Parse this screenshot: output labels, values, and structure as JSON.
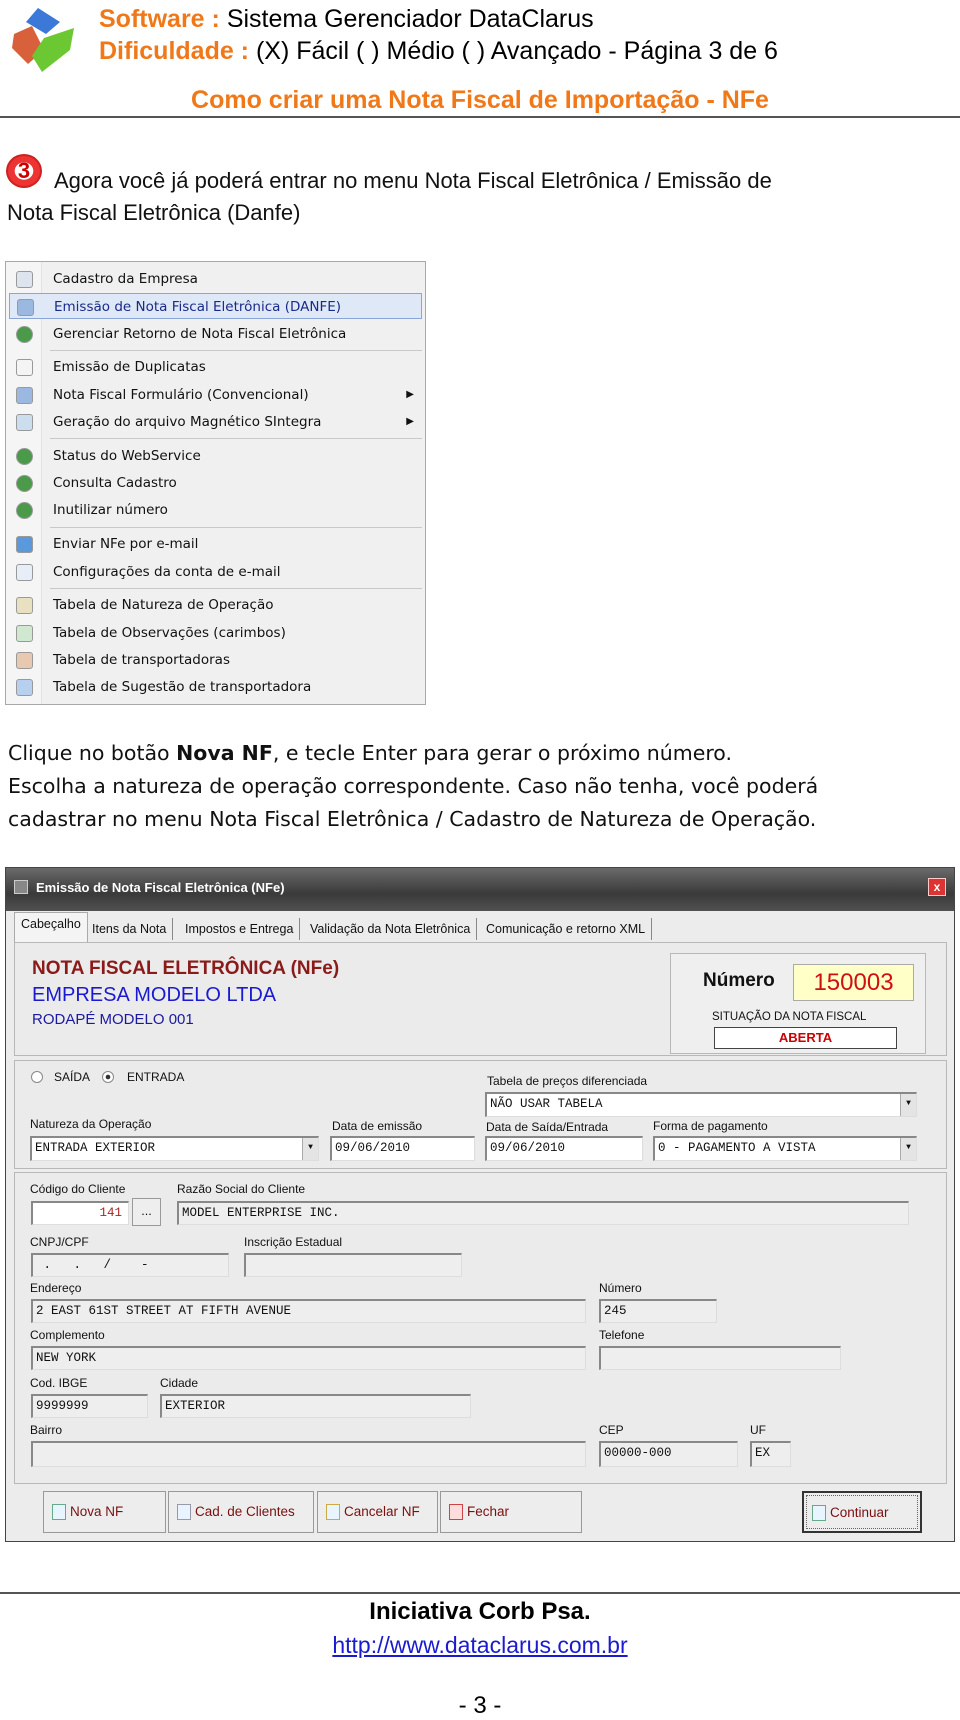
{
  "header": {
    "software_label": "Software :",
    "software_value": "Sistema Gerenciador DataClarus",
    "difficulty_label": "Dificuldade :",
    "difficulty_value": "(X) Fácil ( ) Médio ( ) Avançado - Página 3 de 6",
    "title": "Como criar uma Nota Fiscal de Importação - NFe",
    "accent": "#f07818"
  },
  "step": {
    "number": "3",
    "line1": "Agora você já poderá entrar no menu Nota Fiscal Eletrônica / Emissão de",
    "line2": "Nota Fiscal Eletrônica (Danfe)"
  },
  "menu": {
    "items": [
      {
        "label": "Cadastro da Empresa",
        "icon": "document-icon"
      },
      {
        "label": "Emissão de Nota Fiscal Eletrônica (DANFE)",
        "icon": "printer-check-icon",
        "selected": true
      },
      {
        "label": "Gerenciar Retorno de Nota Fiscal Eletrônica",
        "icon": "globe-lock-icon"
      },
      {
        "label": "Emissão de Duplicatas",
        "icon": "page-icon"
      },
      {
        "label": "Nota Fiscal Formulário (Convencional)",
        "icon": "printer-check-icon",
        "submenu": true
      },
      {
        "label": "Geração do arquivo Magnético SIntegra",
        "icon": "disc-arrow-icon",
        "submenu": true
      },
      {
        "label": "Status do WebService",
        "icon": "globe-lock-icon"
      },
      {
        "label": "Consulta Cadastro",
        "icon": "globe-lock-icon"
      },
      {
        "label": "Inutilizar número",
        "icon": "globe-lock-icon"
      },
      {
        "label": "Enviar NFe por e-mail",
        "icon": "email-check-icon"
      },
      {
        "label": "Configurações da conta de e-mail",
        "icon": "email-config-icon"
      },
      {
        "label": "Tabela de Natureza de Operação",
        "icon": "table-icon"
      },
      {
        "label": "Tabela de Observações (carimbos)",
        "icon": "table-add-icon"
      },
      {
        "label": "Tabela de transportadoras",
        "icon": "table-truck-icon"
      },
      {
        "label": "Tabela de Sugestão de transportadora",
        "icon": "table-arrows-icon"
      }
    ]
  },
  "instructions": {
    "l1_pre": "Clique no botão ",
    "l1_bold": "Nova NF",
    "l1_post": ", e tecle Enter para gerar o próximo número.",
    "l2": "Escolha a natureza de operação correspondente. Caso não tenha, você poderá",
    "l3": "cadastrar no menu Nota Fiscal Eletrônica / Cadastro de Natureza de Operação."
  },
  "window": {
    "title": "Emissão de Nota Fiscal Eletrônica (NFe)",
    "tabs": [
      "Cabeçalho",
      "Itens da Nota",
      "Impostos e Entrega",
      "Validação da Nota Eletrônica",
      "Comunicação e retorno XML"
    ],
    "nf_title": "NOTA FISCAL ELETRÔNICA (NFe)",
    "company": "EMPRESA MODELO LTDA",
    "footer_model": "RODAPÉ MODELO 001",
    "numero_label": "Número",
    "numero_value": "150003",
    "situacao_label": "SITUAÇÃO DA NOTA FISCAL",
    "situacao_value": "ABERTA",
    "radio_saida": "SAÍDA",
    "radio_entrada": "ENTRADA",
    "radio_selected": "ENTRADA",
    "tabela_label": "Tabela de preços diferenciada",
    "tabela_value": "NÃO USAR TABELA",
    "natureza_label": "Natureza da Operação",
    "natureza_value": "ENTRADA EXTERIOR",
    "data_emissao_label": "Data de emissão",
    "data_emissao_value": "09/06/2010",
    "data_saida_label": "Data de Saída/Entrada",
    "data_saida_value": "09/06/2010",
    "forma_label": "Forma de pagamento",
    "forma_value": "0 - PAGAMENTO A VISTA",
    "codigo_label": "Código do Cliente",
    "codigo_value": "141",
    "lookup": "...",
    "razao_label": "Razão Social do Cliente",
    "razao_value": "MODEL ENTERPRISE INC.",
    "cnpj_label": "CNPJ/CPF",
    "cnpj_value": " .   .   /    -",
    "ie_label": "Inscrição Estadual",
    "ie_value": "",
    "endereco_label": "Endereço",
    "endereco_value": "2 EAST 61ST STREET AT FIFTH AVENUE",
    "numero2_label": "Número",
    "numero2_value": "245",
    "complemento_label": "Complemento",
    "complemento_value": "NEW YORK",
    "telefone_label": "Telefone",
    "telefone_value": "",
    "ibge_label": "Cod. IBGE",
    "ibge_value": "9999999",
    "cidade_label": "Cidade",
    "cidade_value": "EXTERIOR",
    "bairro_label": "Bairro",
    "bairro_value": "",
    "cep_label": "CEP",
    "cep_value": "00000-000",
    "uf_label": "UF",
    "uf_value": "EX",
    "buttons": {
      "nova": "Nova NF",
      "cad": "Cad. de Clientes",
      "cancelar": "Cancelar NF",
      "fechar": "Fechar",
      "continuar": "Continuar"
    }
  },
  "footer": {
    "org": "Iniciativa Corb Psa.",
    "url": "http://www.dataclarus.com.br",
    "page": "- 3 -"
  }
}
